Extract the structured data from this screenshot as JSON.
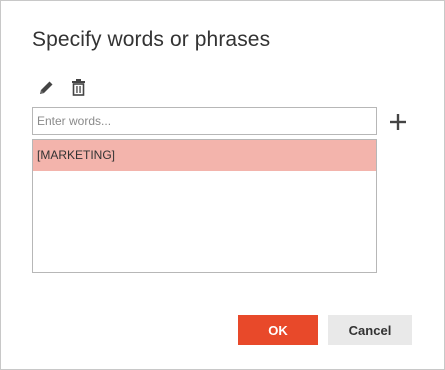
{
  "dialog": {
    "title": "Specify words or phrases"
  },
  "toolbar": {
    "edit_icon": "pencil-icon",
    "delete_icon": "trash-icon"
  },
  "input": {
    "value": "",
    "placeholder": "Enter words..."
  },
  "add_icon": "plus-icon",
  "list": {
    "items": [
      {
        "label": "[MARKETING]",
        "selected": true
      }
    ]
  },
  "buttons": {
    "ok_label": "OK",
    "cancel_label": "Cancel"
  },
  "colors": {
    "accent": "#e8492a",
    "selected_row": "#f3b4ac",
    "cancel_bg": "#e9e9e9"
  }
}
